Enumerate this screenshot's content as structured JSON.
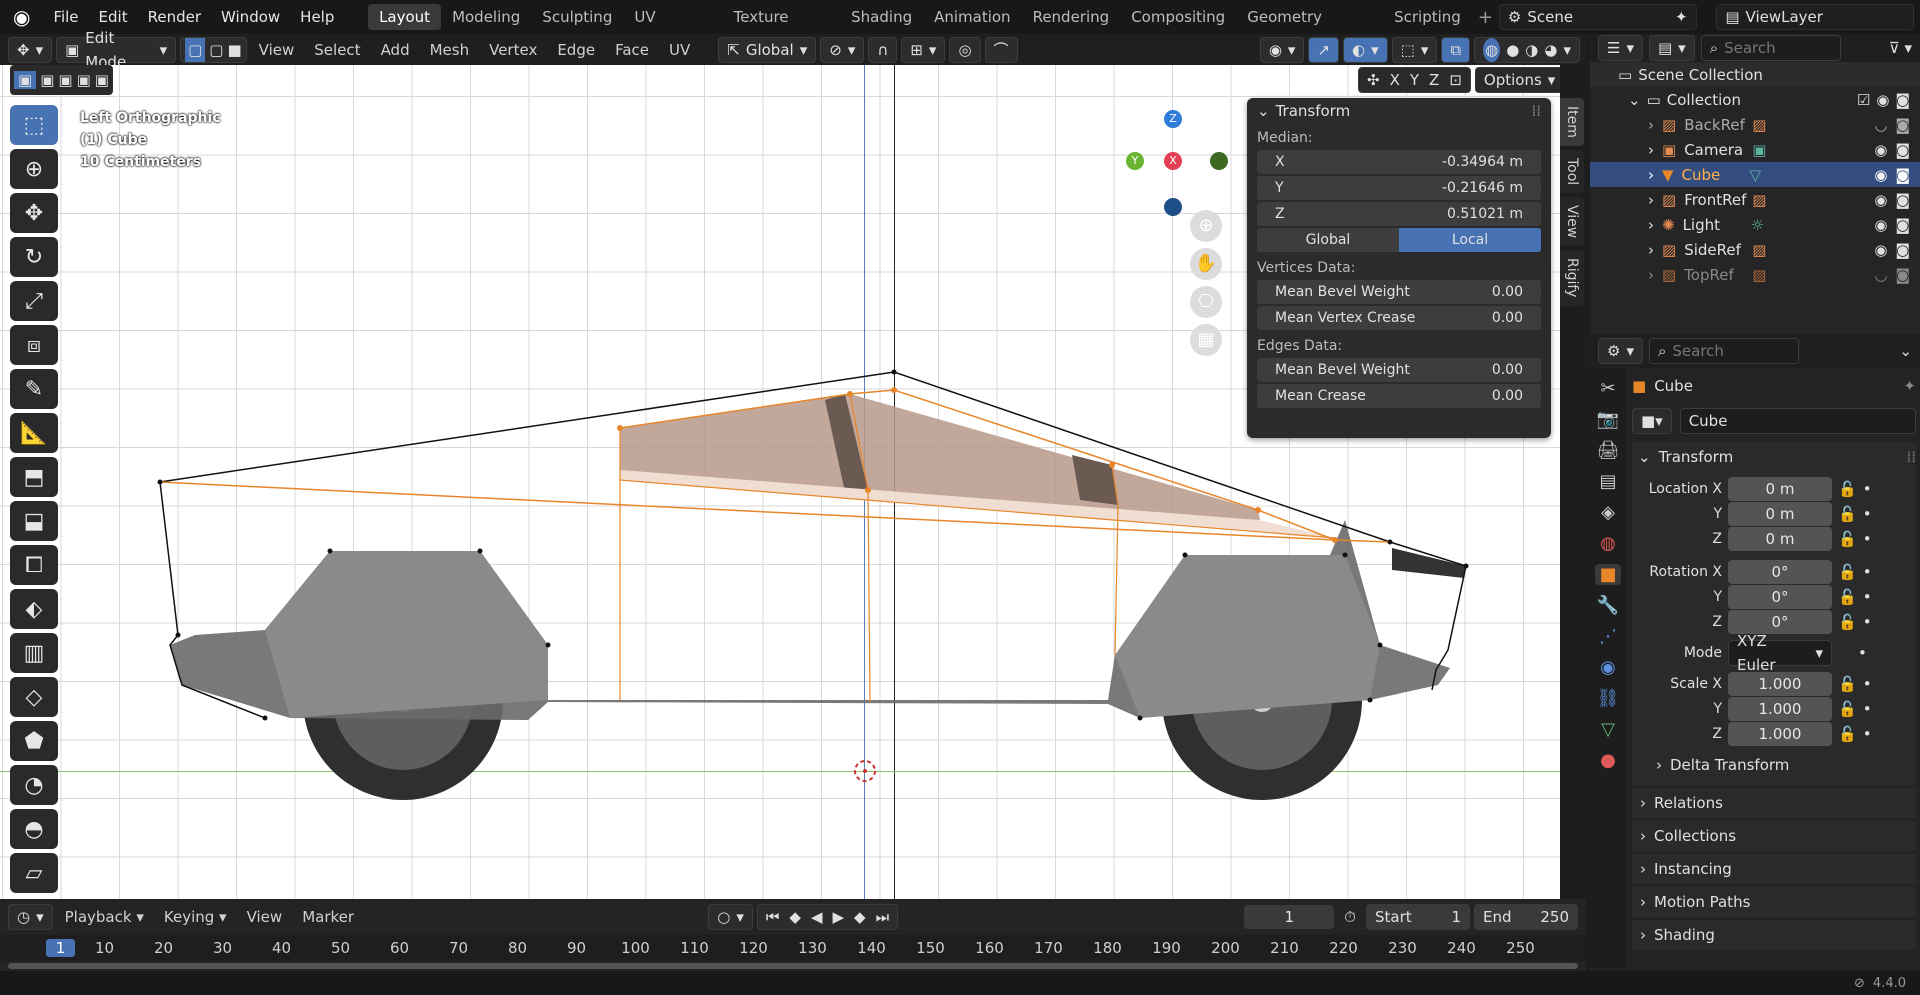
{
  "menu": [
    "File",
    "Edit",
    "Render",
    "Window",
    "Help"
  ],
  "workspaces": [
    "Layout",
    "Modeling",
    "Sculpting",
    "UV Editing",
    "Texture Paint",
    "Shading",
    "Animation",
    "Rendering",
    "Compositing",
    "Geometry Nodes",
    "Scripting"
  ],
  "active_workspace": "Layout",
  "scene_name": "Scene",
  "view_layer": "ViewLayer",
  "header": {
    "mode": "Edit Mode",
    "menus": [
      "View",
      "Select",
      "Add",
      "Mesh",
      "Vertex",
      "Edge",
      "Face",
      "UV"
    ],
    "orientation": "Global",
    "axis_labels": [
      "X",
      "Y",
      "Z"
    ],
    "options_label": "Options"
  },
  "viewport": {
    "view_name": "Left Orthographic",
    "object_label": "(1) Cube",
    "scale_label": "10 Centimeters",
    "gizmo_axes": [
      "Z",
      "Y",
      "X"
    ]
  },
  "npanel": {
    "title": "Transform",
    "median_label": "Median:",
    "x_label": "X",
    "x_value": "-0.34964 m",
    "y_label": "Y",
    "y_value": "-0.21646 m",
    "z_label": "Z",
    "z_value": "0.51021 m",
    "global_label": "Global",
    "local_label": "Local",
    "vertices_label": "Vertices Data:",
    "mean_bevel_weight_label": "Mean Bevel Weight",
    "vertex_bevel_value": "0.00",
    "mean_vertex_crease_label": "Mean Vertex Crease",
    "vertex_crease_value": "0.00",
    "edges_label": "Edges Data:",
    "edge_bevel_label": "Mean Bevel Weight",
    "edge_bevel_value": "0.00",
    "mean_crease_label": "Mean Crease",
    "edge_crease_value": "0.00",
    "side_tabs": [
      "Item",
      "Tool",
      "View",
      "Rigify"
    ]
  },
  "outliner": {
    "search_placeholder": "Search",
    "scene_collection": "Scene Collection",
    "collection": "Collection",
    "items": [
      {
        "name": "BackRef"
      },
      {
        "name": "Camera"
      },
      {
        "name": "Cube"
      },
      {
        "name": "FrontRef"
      },
      {
        "name": "Light"
      },
      {
        "name": "SideRef"
      },
      {
        "name": "TopRef"
      }
    ]
  },
  "properties": {
    "search_placeholder": "Search",
    "object_name": "Cube",
    "data_name": "Cube",
    "transform_label": "Transform",
    "location_x_label": "Location X",
    "loc_x": "0 m",
    "y_label": "Y",
    "loc_y": "0 m",
    "z_label": "Z",
    "loc_z": "0 m",
    "rotation_x_label": "Rotation X",
    "rot_x": "0°",
    "rot_y": "0°",
    "rot_z": "0°",
    "mode_label": "Mode",
    "mode_value": "XYZ Euler",
    "scale_x_label": "Scale X",
    "scale_x": "1.000",
    "scale_y": "1.000",
    "scale_z": "1.000",
    "delta_transform": "Delta Transform",
    "sections": [
      "Relations",
      "Collections",
      "Instancing",
      "Motion Paths",
      "Shading"
    ]
  },
  "timeline": {
    "menus": [
      "Playback",
      "Keying",
      "View",
      "Marker"
    ],
    "current_frame": "1",
    "start_label": "Start",
    "start": "1",
    "end_label": "End",
    "end": "250",
    "ruler": [
      "1",
      "10",
      "20",
      "30",
      "40",
      "50",
      "60",
      "70",
      "80",
      "90",
      "100",
      "110",
      "120",
      "130",
      "140",
      "150",
      "160",
      "170",
      "180",
      "190",
      "200",
      "210",
      "220",
      "230",
      "240",
      "250"
    ]
  },
  "status": {
    "version": "4.4.0"
  },
  "colors": {
    "accent": "#4772b3",
    "selected_orange": "#e8862a",
    "header_bg": "#1f1f1f"
  }
}
